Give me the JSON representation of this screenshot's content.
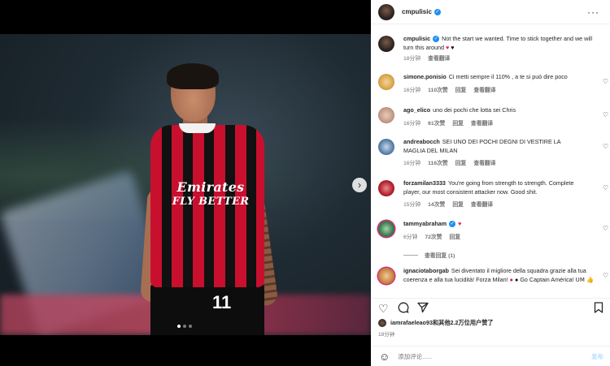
{
  "post": {
    "author": "cmpulisic",
    "caption": "Not the start we wanted. Time to stick together and we will turn this around",
    "caption_emoji_1": "♥",
    "caption_emoji_2": "♥",
    "caption_time": "18分钟",
    "caption_translate": "查看翻译",
    "jersey_sponsor_line1": "Emirates",
    "jersey_sponsor_line2": "FLY BETTER",
    "jersey_number": "11",
    "carousel_slides": 3,
    "carousel_active": 1
  },
  "comments": [
    {
      "user": "simone.ponisio",
      "text": "Ci metti sempre il 110% , a te si può dire poco",
      "time": "16分钟",
      "likes": "110次赞",
      "reply": "回复",
      "translate": "查看翻译",
      "avatar_color": "#d9a64a"
    },
    {
      "user": "ago_elico",
      "text": "uno dei pochi che lotta sei Chris",
      "time": "16分钟",
      "likes": "61次赞",
      "reply": "回复",
      "translate": "查看翻译",
      "avatar_color": "#c29a86"
    },
    {
      "user": "andreabocch",
      "text": "SEI UNO DEI POCHI DEGNI DI VESTIRE LA MAGLIA DEL MILAN",
      "time": "16分钟",
      "likes": "116次赞",
      "reply": "回复",
      "translate": "查看翻译",
      "avatar_color": "#5b7fa8"
    },
    {
      "user": "forzamilan3333",
      "text": "You're going from strength to strength. Complete player, our most consistent attacker now. Good shit.",
      "time": "15分钟",
      "likes": "14次赞",
      "reply": "回复",
      "translate": "查看翻译",
      "avatar_color": "#b3202e"
    },
    {
      "user": "tammyabraham",
      "text": "",
      "emoji": "♥",
      "time": "6分钟",
      "likes": "72次赞",
      "reply": "回复",
      "translate": "",
      "avatar_color": "#3a7a4c",
      "verified": true
    },
    {
      "user": "ignaciotaborgab",
      "text": "Sei diventato il migliore della squadra grazie alla tua coerenza e alla tua lucidità! Forza Milan!",
      "tail": "Go Captain América! 𝖴𝖬 👍",
      "time": "",
      "likes": "",
      "reply": "",
      "translate": "",
      "avatar_color": "#c9843f"
    }
  ],
  "replies_label": "查看回复 (1)",
  "likes_line": "iamrafaeleao93和其他2.2万位用户赞了",
  "post_time": "18分钟",
  "add_comment_placeholder": "添加评论......",
  "post_button": "发布",
  "icons": {
    "like": "heart-icon",
    "comment": "comment-icon",
    "share": "share-icon",
    "save": "bookmark-icon",
    "emoji": "smile-icon",
    "more": "more-icon",
    "next": "chevron-right-icon"
  }
}
